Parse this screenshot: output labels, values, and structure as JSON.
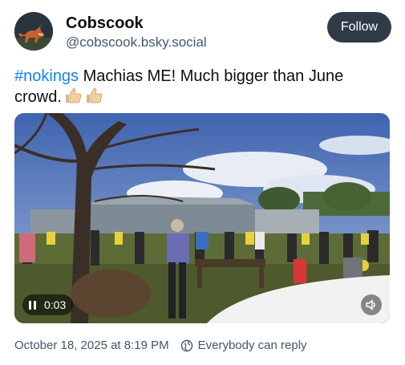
{
  "post": {
    "author_name": "Cobscook",
    "author_handle": "@cobscook.bsky.social",
    "follow_label": "Follow",
    "hashtag": "#nokings",
    "text": " Machias ME! Much bigger than June crowd.",
    "emoji_count": 2,
    "emoji_name": "thumbs-up-medium-light-skin-tone"
  },
  "video": {
    "current_time": "0:03",
    "state": "playing",
    "muted": false
  },
  "footer": {
    "timestamp": "October 18, 2025 at 8:19 PM",
    "reply_setting": "Everybody can reply"
  },
  "colors": {
    "hashtag": "#1083fe",
    "follow_button_bg": "#2f3b47",
    "secondary_text": "#42576c"
  }
}
